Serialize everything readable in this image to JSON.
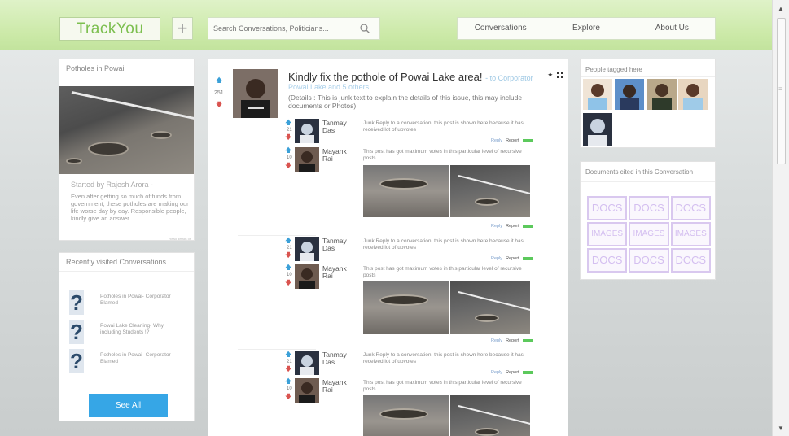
{
  "header": {
    "logo": "TrackYou",
    "plus": "+",
    "search_placeholder": "Search Conversations, Politicians...",
    "nav": [
      "Conversations",
      "Explore",
      "About Us"
    ]
  },
  "left": {
    "topic_title": "Potholes in Powai",
    "started_by": "Started by Rajesh Arora -",
    "description": "Even after getting so much of funds from government, these potholes are making our life worse day by day. Responsible people, kindly give an answer.",
    "tiny": "Read details of",
    "recent_title": "Recently visited Conversations",
    "recent_items": [
      "Potholes in Powai- Corporator Blamed",
      "Powai Lake Cleaning- Why including Students !?",
      "Potholes in Powai- Corporator Blamed"
    ],
    "see_all": "See All"
  },
  "post": {
    "title": "Kindly fix the pothole of Powai Lake area!",
    "to": "- to Corporator",
    "tagline": "Powai Lake and 5 others",
    "details": "(Details : This is junk text to explain the details of this issue, this may include documents or Photos)",
    "votes": "251",
    "replies": [
      {
        "user1": {
          "first": "Tanmay",
          "last": "Das",
          "votes": "21"
        },
        "reply_text": "Junk Reply to a conversation, this post is shown here because it has received lot of upvotes",
        "user2": {
          "first": "Mayank",
          "last": "Rai",
          "votes": "10"
        },
        "nested_text": "This post has got maximum votes in this particular level of recursive posts"
      },
      {
        "user1": {
          "first": "Tanmay",
          "last": "Das",
          "votes": "21"
        },
        "reply_text": "Junk Reply to a conversation, this post is shown here because it has received lot of upvotes",
        "user2": {
          "first": "Mayank",
          "last": "Rai",
          "votes": "10"
        },
        "nested_text": "This post has got maximum votes in this particular level of recursive posts"
      },
      {
        "user1": {
          "first": "Tanmay",
          "last": "Das",
          "votes": "21"
        },
        "reply_text": "Junk Reply to a conversation, this post is shown here because it has received lot of upvotes",
        "user2": {
          "first": "Mayank",
          "last": "Rai",
          "votes": "10"
        },
        "nested_text": "This post has got maximum votes in this particular level of recursive posts"
      }
    ],
    "reply_label": "Reply",
    "report_label": "Report"
  },
  "right": {
    "people_title": "People tagged here",
    "docs_title": "Documents cited in this Conversation",
    "doc_tiles": [
      "DOCS",
      "DOCS",
      "DOCS",
      "IMAGES",
      "IMAGES",
      "IMAGES",
      "DOCS",
      "DOCS",
      "DOCS"
    ]
  },
  "colors": {
    "accent": "#36a6e6",
    "green": "#7cbf4f",
    "doc": "#d4bff0"
  }
}
